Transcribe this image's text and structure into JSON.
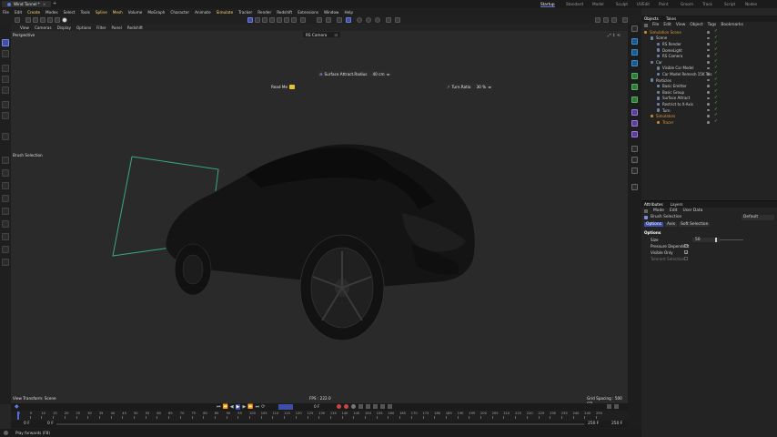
{
  "window": {
    "doc_tab": "Wind Tunnel *",
    "add_tab": "+"
  },
  "layouts": [
    "Startup",
    "Standard",
    "Model",
    "Sculpt",
    "UVEdit",
    "Paint",
    "Groom",
    "Track",
    "Script",
    "Nodes"
  ],
  "menu": [
    "File",
    "Edit",
    "Create",
    "Modes",
    "Select",
    "Tools",
    "Spline",
    "Mesh",
    "Volume",
    "MoGraph",
    "Character",
    "Animate",
    "Simulate",
    "Tracker",
    "Render",
    "Redshift",
    "Extensions",
    "Window",
    "Help"
  ],
  "viewport_menu": [
    "View",
    "Cameras",
    "Display",
    "Options",
    "Filter",
    "Panel",
    "Redshift"
  ],
  "viewport": {
    "name": "Perspective",
    "camera": "RS Camera",
    "hud": [
      {
        "id": "hud-radius",
        "label": "Surface Attract.Radius",
        "value": "40 cm"
      },
      {
        "id": "hud-readme",
        "label": "Read Me"
      },
      {
        "id": "hud-turn",
        "label": "Turn.Ratio",
        "value": "30 %"
      }
    ],
    "brush_label": "Brush Selection",
    "status_left": "View Transform: Scene",
    "fps": "FPS : 222.0",
    "grid": "Grid Spacing : 500 cm"
  },
  "timeline": {
    "current_frame": "0 F",
    "start": "0 F",
    "start2": "0 F",
    "end": "250 F",
    "end2": "250 F",
    "ruler": [
      "0",
      "5",
      "10",
      "15",
      "20",
      "25",
      "30",
      "35",
      "40",
      "45",
      "50",
      "55",
      "60",
      "65",
      "70",
      "75",
      "80",
      "85",
      "90",
      "95",
      "100",
      "105",
      "110",
      "115",
      "120",
      "125",
      "130",
      "135",
      "140",
      "145",
      "150",
      "155",
      "160",
      "165",
      "170",
      "175",
      "180",
      "185",
      "190",
      "195",
      "200",
      "205",
      "210",
      "215",
      "220",
      "225",
      "230",
      "235",
      "240",
      "245",
      "250"
    ]
  },
  "status": "Play forwards (F8)",
  "objects_panel": {
    "tabs": [
      "Objects",
      "Takes"
    ],
    "menu": [
      "File",
      "Edit",
      "View",
      "Object",
      "Tags",
      "Bookmarks"
    ],
    "rows": [
      {
        "name": "Simulation Scene",
        "indent": 0,
        "color": "#e39a33"
      },
      {
        "name": "Scene",
        "indent": 1,
        "color": "#cfcfcf"
      },
      {
        "name": "RS Render",
        "indent": 2,
        "color": "#cfcfcf"
      },
      {
        "name": "DomeLight",
        "indent": 2,
        "color": "#cfcfcf"
      },
      {
        "name": "RS Camera",
        "indent": 2,
        "color": "#cfcfcf"
      },
      {
        "name": "Car",
        "indent": 1,
        "color": "#cfcfcf"
      },
      {
        "name": "Visible Car Model",
        "indent": 2,
        "color": "#cfcfcf"
      },
      {
        "name": "Car Model Remesh 15K Tris",
        "indent": 2,
        "color": "#cfcfcf"
      },
      {
        "name": "Particles",
        "indent": 1,
        "color": "#cfcfcf"
      },
      {
        "name": "Basic Emitter",
        "indent": 2,
        "color": "#cfcfcf"
      },
      {
        "name": "Basic Group",
        "indent": 2,
        "color": "#cfcfcf"
      },
      {
        "name": "Surface Attract",
        "indent": 2,
        "color": "#cfcfcf"
      },
      {
        "name": "Restrict to X-Axis",
        "indent": 2,
        "color": "#cfcfcf"
      },
      {
        "name": "Turn",
        "indent": 2,
        "color": "#cfcfcf"
      },
      {
        "name": "Simulators",
        "indent": 1,
        "color": "#e39a33"
      },
      {
        "name": "Tracer",
        "indent": 2,
        "color": "#e39a33"
      }
    ]
  },
  "attributes_panel": {
    "tabs": [
      "Attributes",
      "Layers"
    ],
    "menu": [
      "Mode",
      "Edit",
      "User Data"
    ],
    "object": "Brush Selection",
    "preset": "Default",
    "subtabs": [
      "Options",
      "Axis",
      "Soft Selection"
    ],
    "section": "Options",
    "fields": [
      {
        "label": "Size",
        "value": "50"
      },
      {
        "label": "Pressure Dependent",
        "value": ""
      },
      {
        "label": "Visible Only",
        "value": ""
      },
      {
        "label": "Tolerant Selection",
        "value": ""
      }
    ]
  }
}
